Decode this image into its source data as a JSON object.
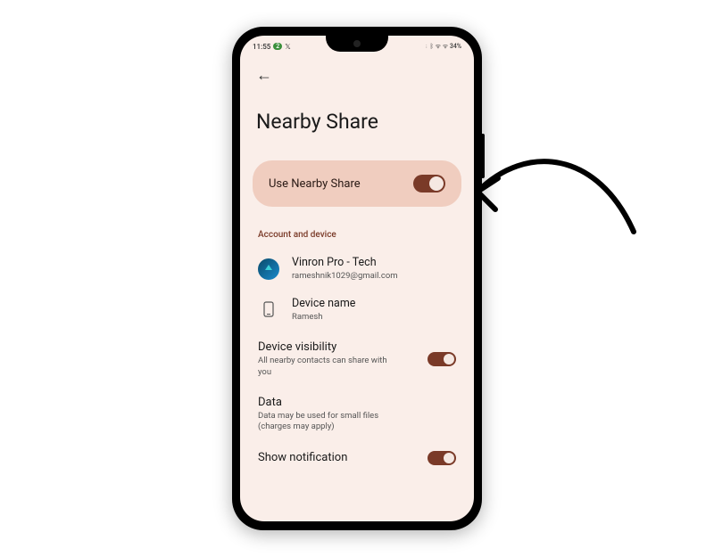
{
  "status": {
    "time": "11:55",
    "badge": "2",
    "twitter_icon": "𝕏",
    "right": "⋮ ᛒ ᯤ ᯤ 34%"
  },
  "page": {
    "title": "Nearby Share"
  },
  "primary_toggle": {
    "label": "Use Nearby Share",
    "on": true
  },
  "sections": {
    "account_header": "Account and device"
  },
  "account": {
    "name": "Vinron Pro - Tech",
    "email": "rameshnik1029@gmail.com"
  },
  "device": {
    "label": "Device name",
    "value": "Ramesh"
  },
  "visibility": {
    "title": "Device visibility",
    "desc": "All nearby contacts can share with you",
    "on": true
  },
  "data_setting": {
    "title": "Data",
    "desc": "Data may be used for small files (charges may apply)"
  },
  "notification": {
    "title": "Show notification",
    "on": true
  }
}
